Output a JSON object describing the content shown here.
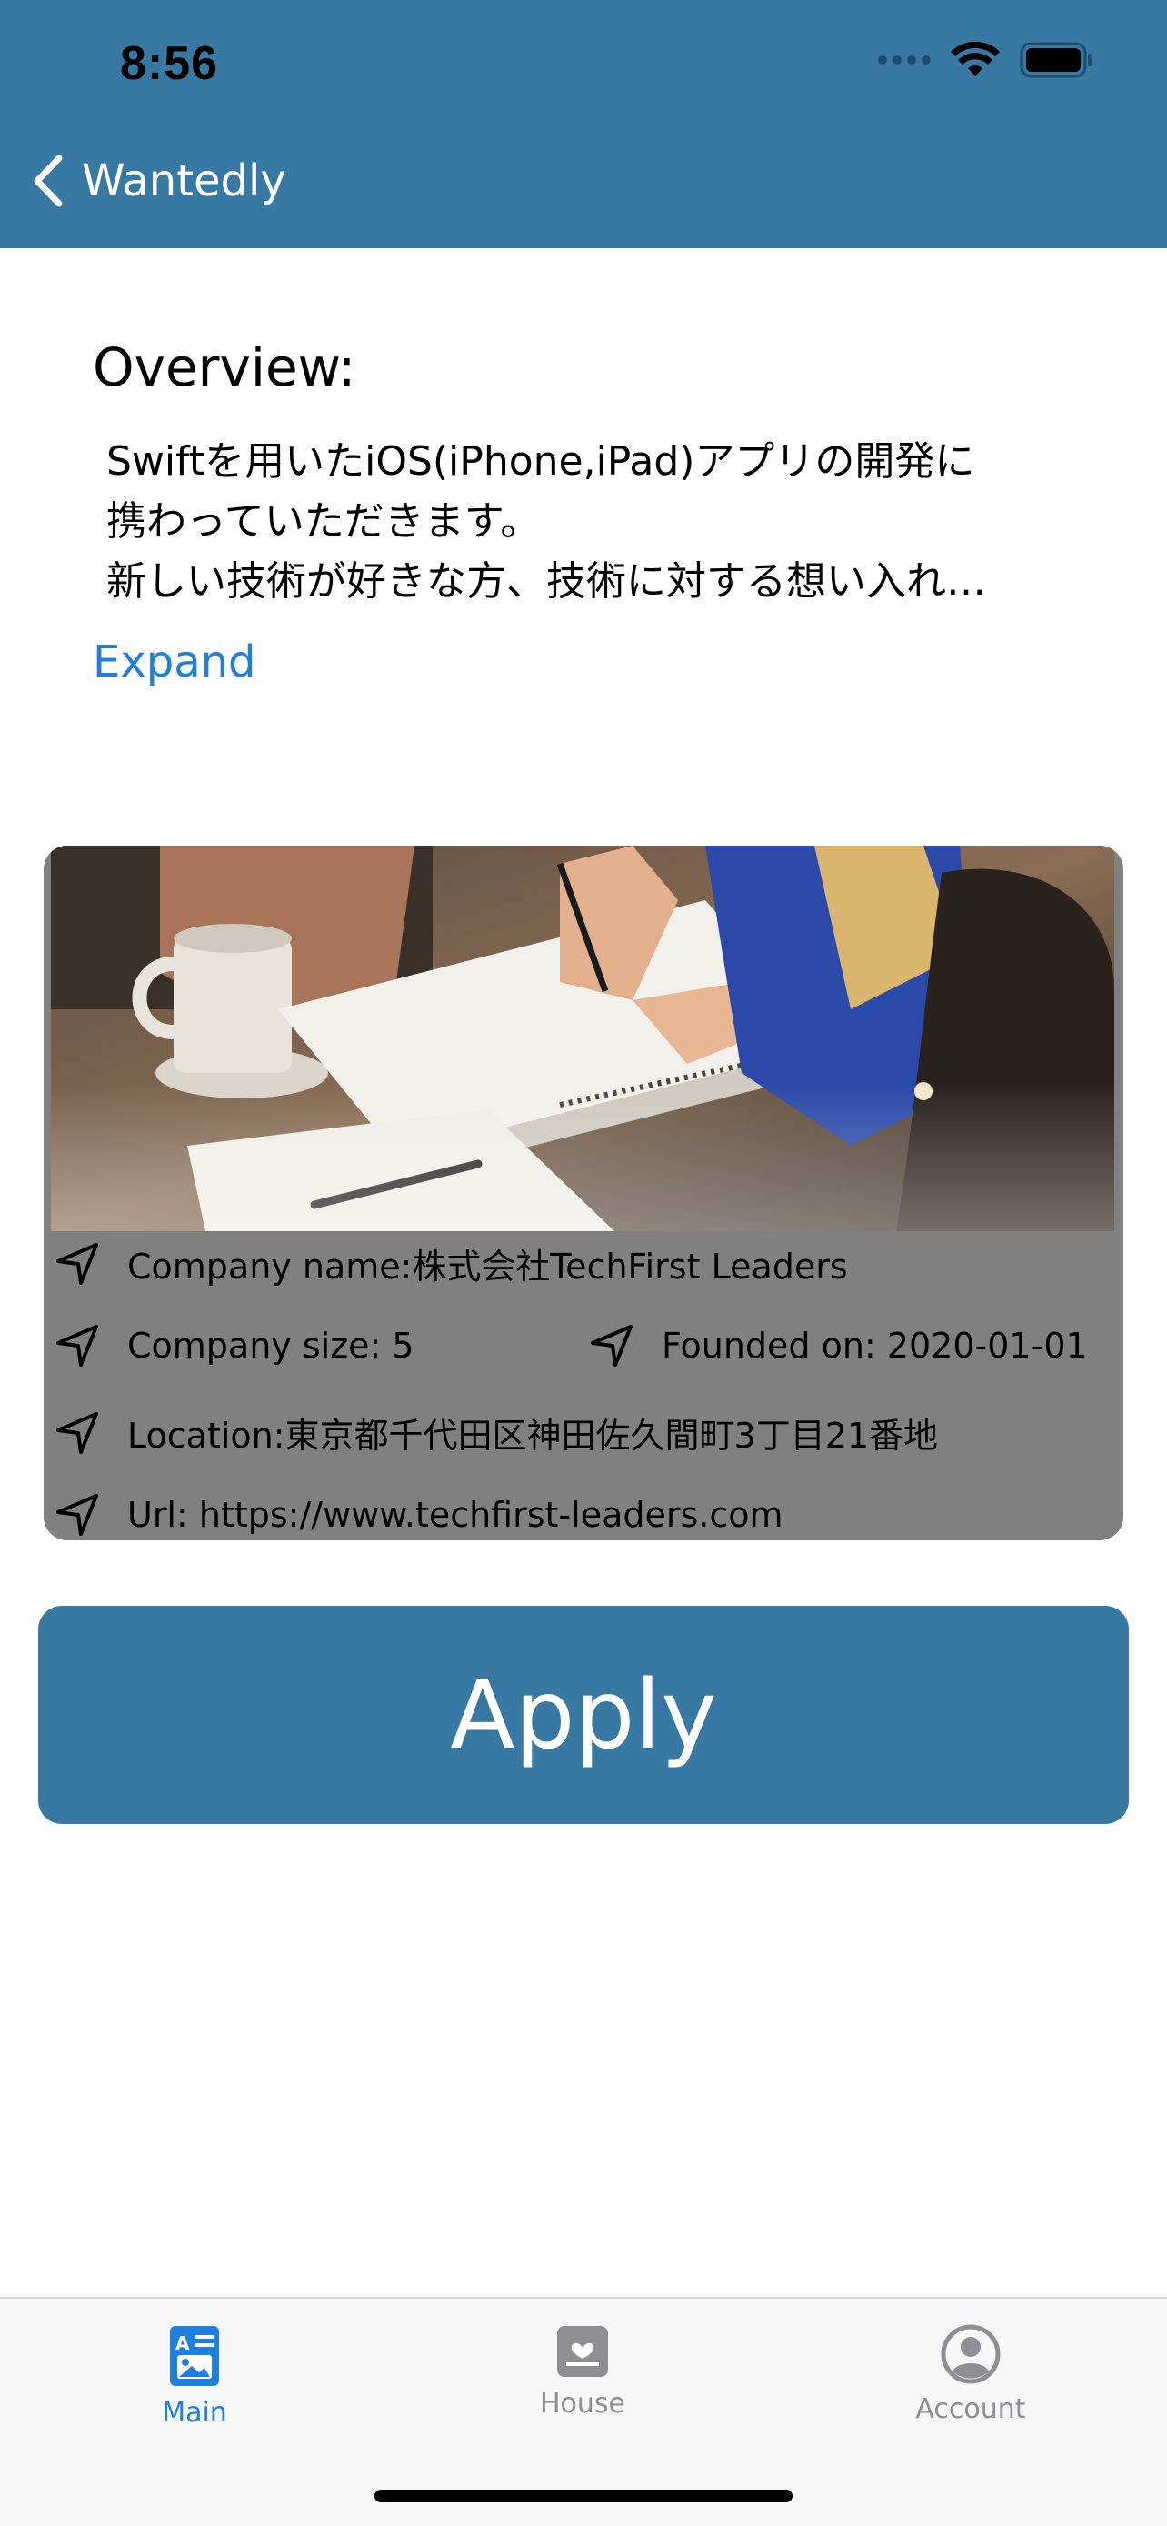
{
  "status_bar": {
    "time": "8:56"
  },
  "nav": {
    "back_label": "Wantedly"
  },
  "overview": {
    "title": "Overview:",
    "lines": [
      "Swiftを用いたiOS(iPhone,iPad)アプリの開発に",
      "携わっていただきます。",
      "新しい技術が好きな方、技術に対する想い入れ…"
    ],
    "expand_label": "Expand"
  },
  "company": {
    "name_text": "Company name:株式会社TechFirst Leaders",
    "size_text": "Company size: 5",
    "founded_text": "Founded on: 2020-01-01",
    "location_text": "Location:東京都千代田区神田佐久間町3丁目21番地",
    "url_text": "Url: https://www.techfirst-leaders.com",
    "row_icon": "location-arrow-icon"
  },
  "apply": {
    "label": "Apply"
  },
  "tab_bar": {
    "tabs": [
      {
        "label": "Main",
        "icon": "main-tab-icon",
        "active": true
      },
      {
        "label": "House",
        "icon": "house-tab-icon",
        "active": false
      },
      {
        "label": "Account",
        "icon": "account-tab-icon",
        "active": false
      }
    ]
  },
  "colors": {
    "header": "#3779a2",
    "card": "#808080",
    "link": "#1e7fe0",
    "tab_active": "#1e7fe0",
    "tab_inactive": "#8e8e93"
  }
}
